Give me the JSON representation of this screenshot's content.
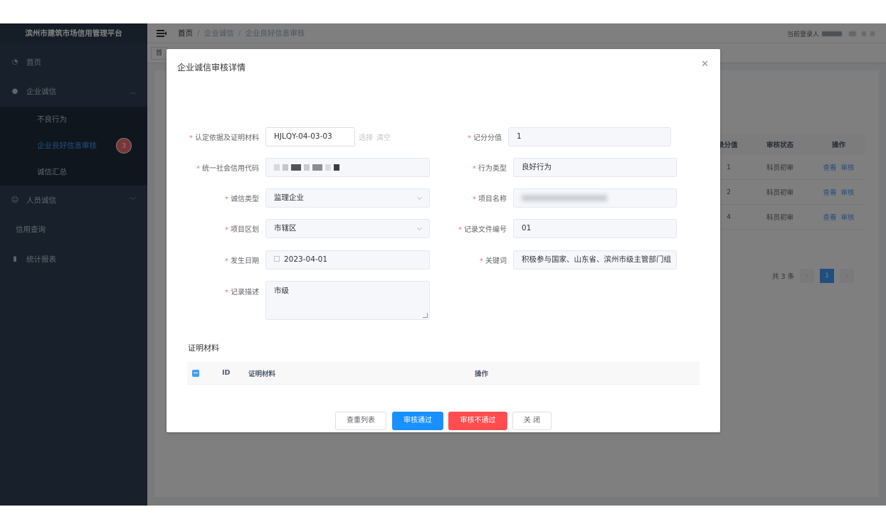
{
  "sidebar": {
    "title": "滨州市建筑市场信用管理平台",
    "items": [
      {
        "label": "首页",
        "icon": "dashboard-icon"
      },
      {
        "label": "企业诚信",
        "icon": "github-icon"
      },
      {
        "label": "人员诚信",
        "icon": "peoples-icon"
      },
      {
        "label": "信用查询"
      },
      {
        "label": "统计报表",
        "icon": "chart-icon"
      }
    ],
    "subitems": [
      {
        "label": "不良行为"
      },
      {
        "label": "企业良好信息审核",
        "badge": "3"
      },
      {
        "label": "诚信汇总"
      }
    ]
  },
  "header": {
    "breadcrumb": [
      "首页",
      "企业诚信",
      "企业良好信息审核"
    ],
    "user_label": "当前登录人"
  },
  "tags": {
    "first": "首"
  },
  "table": {
    "columns": [
      "录分值",
      "审核状态",
      "操作"
    ],
    "rows": [
      {
        "score": "1",
        "status": "科员初审",
        "view": "查看",
        "audit": "审核"
      },
      {
        "score": "2",
        "status": "科员初审",
        "view": "查看",
        "audit": "审核"
      },
      {
        "score": "4",
        "status": "科员初审",
        "view": "查看",
        "audit": "审核"
      }
    ],
    "total": "共 3 条",
    "page": "1"
  },
  "dialog": {
    "title": "企业诚信审核详情",
    "fields": {
      "basis": {
        "label": "认定依据及证明材料",
        "value": "HJLQY-04-03-03",
        "select": "选择",
        "clear": "清空"
      },
      "score": {
        "label": "记分分值",
        "value": "1"
      },
      "credit_code": {
        "label": "统一社会信用代码"
      },
      "behavior_type": {
        "label": "行为类型",
        "value": "良好行为"
      },
      "credit_type": {
        "label": "诚信类型",
        "value": "监理企业"
      },
      "project_name": {
        "label": "项目名称"
      },
      "region": {
        "label": "项目区划",
        "value": "市辖区"
      },
      "doc_no": {
        "label": "记录文件编号",
        "value": "01"
      },
      "date": {
        "label": "发生日期",
        "value": "2023-04-01"
      },
      "keywords": {
        "label": "关键词",
        "value": "积极参与国家、山东省、滨州市级主管部门组"
      },
      "description": {
        "label": "记录描述",
        "value": "市级"
      }
    },
    "materials": {
      "title": "证明材料",
      "columns": [
        "ID",
        "证明材料",
        "操作"
      ]
    },
    "buttons": {
      "check": "查重列表",
      "approve": "审核通过",
      "reject": "审核不通过",
      "close": "关 闭"
    }
  }
}
